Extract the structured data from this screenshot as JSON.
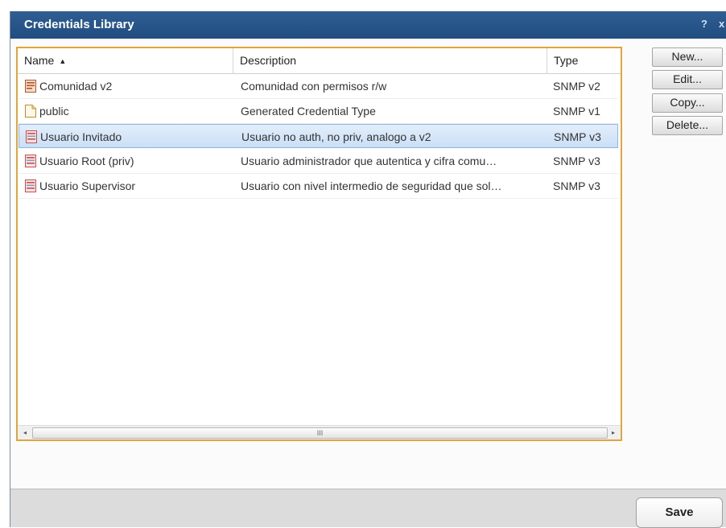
{
  "window": {
    "title": "Credentials Library",
    "help_label": "?",
    "close_label": "x"
  },
  "table": {
    "columns": {
      "name": "Name",
      "description": "Description",
      "type": "Type"
    },
    "sort_indicator": "▲",
    "rows": [
      {
        "name": "Comunidad v2",
        "description": "Comunidad con permisos r/w",
        "type": "SNMP v2",
        "icon": "community-credential-icon",
        "selected": false
      },
      {
        "name": "public",
        "description": "Generated Credential Type",
        "type": "SNMP v1",
        "icon": "generic-credential-icon",
        "selected": false
      },
      {
        "name": "Usuario Invitado",
        "description": "Usuario no auth, no priv, analogo a v2",
        "type": "SNMP v3",
        "icon": "user-credential-icon",
        "selected": true
      },
      {
        "name": "Usuario Root (priv)",
        "description": "Usuario administrador que autentica y cifra comu…",
        "type": "SNMP v3",
        "icon": "user-credential-icon",
        "selected": false
      },
      {
        "name": "Usuario Supervisor",
        "description": "Usuario con nivel intermedio de seguridad que sol…",
        "type": "SNMP v3",
        "icon": "user-credential-icon",
        "selected": false
      }
    ],
    "scrollbar": {
      "left_arrow": "◂",
      "right_arrow": "▸",
      "grip": "III"
    }
  },
  "actions": {
    "new_label": "New...",
    "edit_label": "Edit...",
    "copy_label": "Copy...",
    "delete_label": "Delete..."
  },
  "footer": {
    "save_label": "Save"
  },
  "colors": {
    "title_bar": "#2a5a8f",
    "list_border": "#e0a53a",
    "selected_row": "#cadff6"
  }
}
